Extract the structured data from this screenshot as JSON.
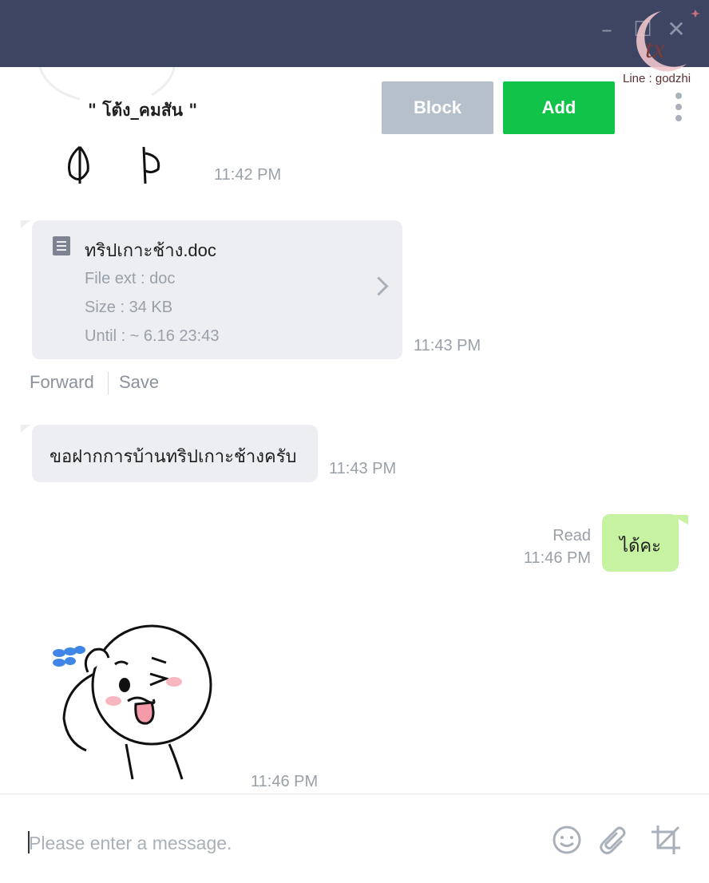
{
  "window": {
    "minimize_glyph": "–",
    "maximize_glyph": "☐",
    "close_glyph": "✕"
  },
  "watermark": {
    "text": "Line : godzhi"
  },
  "header": {
    "contact_name": "\" โต้ง_คมสัน \"",
    "block_label": "Block",
    "add_label": "Add"
  },
  "messages": {
    "sticker1_time": "11:42 PM",
    "file": {
      "name": "ทริปเกาะช้าง.doc",
      "ext": "File ext : doc",
      "size": "Size : 34 KB",
      "until": "Until : ~ 6.16 23:43",
      "time": "11:43 PM",
      "forward_label": "Forward",
      "save_label": "Save"
    },
    "text_in": {
      "text": "ขอฝากการบ้านทริปเกาะช้างครับ",
      "time": "11:43 PM"
    },
    "text_out": {
      "text": "ได้คะ",
      "read_label": "Read",
      "time": "11:46 PM"
    },
    "sticker2_time": "11:46 PM"
  },
  "composer": {
    "placeholder": "Please enter a message."
  },
  "icons": [
    "minimize-icon",
    "maximize-icon",
    "close-icon",
    "more-icon",
    "document-icon",
    "chevron-right-icon",
    "emoji-icon",
    "attachment-icon",
    "crop-icon"
  ],
  "colors": {
    "titlebar": "#3d4562",
    "add": "#11c449",
    "block": "#b6c0cb",
    "bubble_in": "#edeef2",
    "bubble_out": "#c6f2a2"
  }
}
